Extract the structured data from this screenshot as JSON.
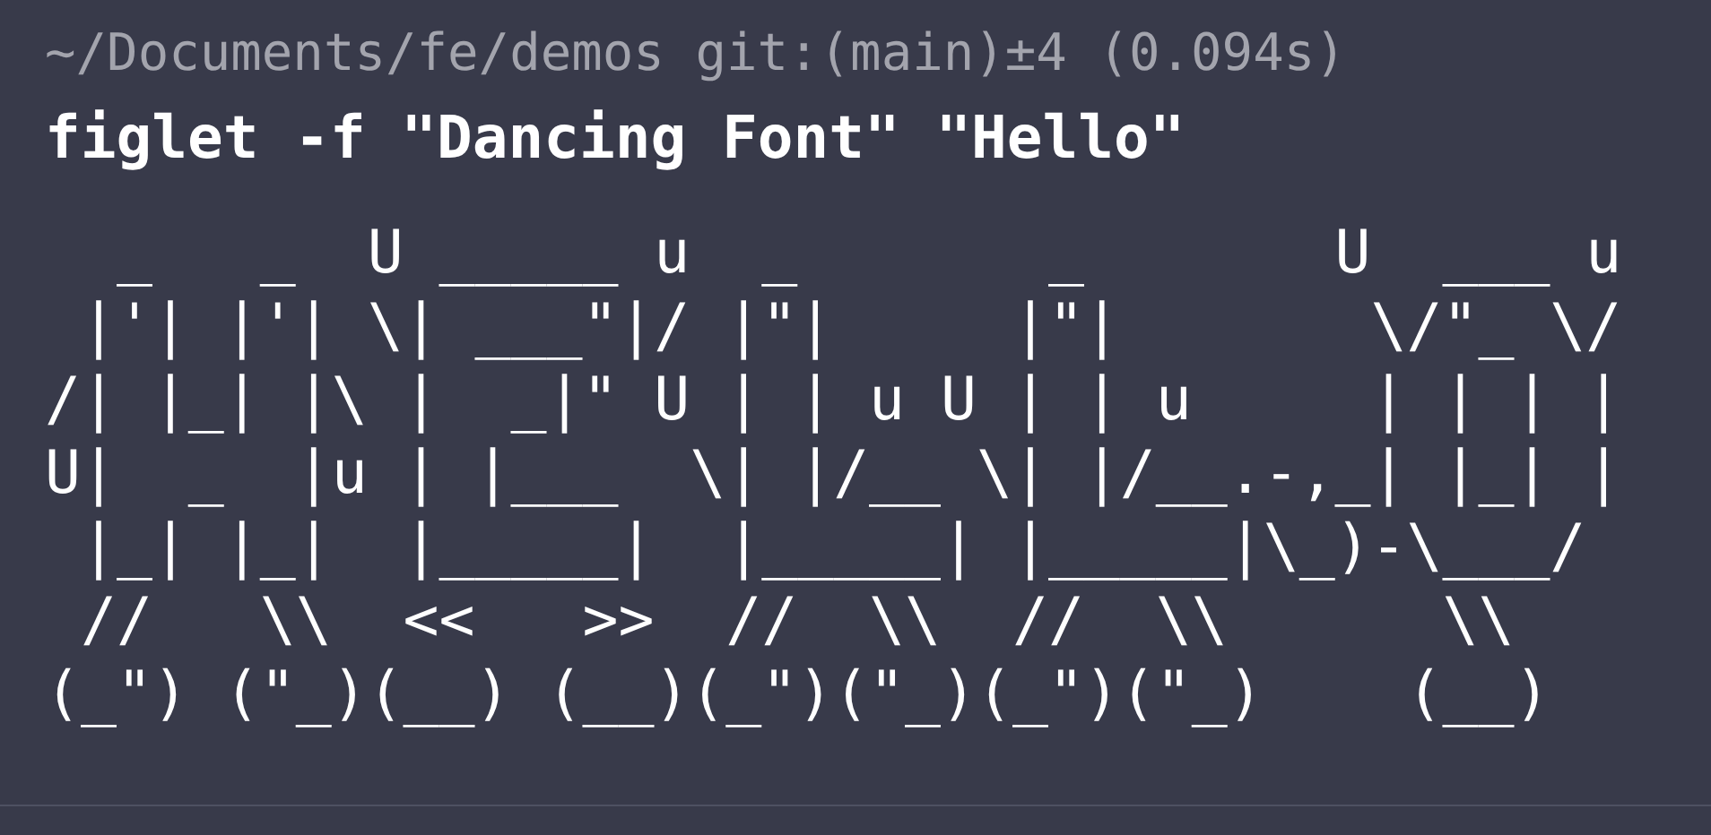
{
  "prompt": "~/Documents/fe/demos git:(main)±4 (0.094s)",
  "command": "figlet -f \"Dancing Font\" \"Hello\"",
  "output_lines": [
    "  _   _  U _____ u  _       _       U  ___ u",
    " |'| |'| \\| ___\"|/ |\"|     |\"|       \\/\"_ \\/",
    "/| |_| |\\ |  _|\" U | | u U | | u     | | | |",
    "U|  _  |u | |___  \\| |/__ \\| |/__.-,_| |_| |",
    " |_| |_|  |_____|  |_____| |_____|\\_)-\\___/",
    " //   \\\\  <<   >>  //  \\\\  //  \\\\      \\\\",
    "(_\") (\"_)(__) (__)(_\")(\"_)(_\")(\"_)    (__)"
  ]
}
